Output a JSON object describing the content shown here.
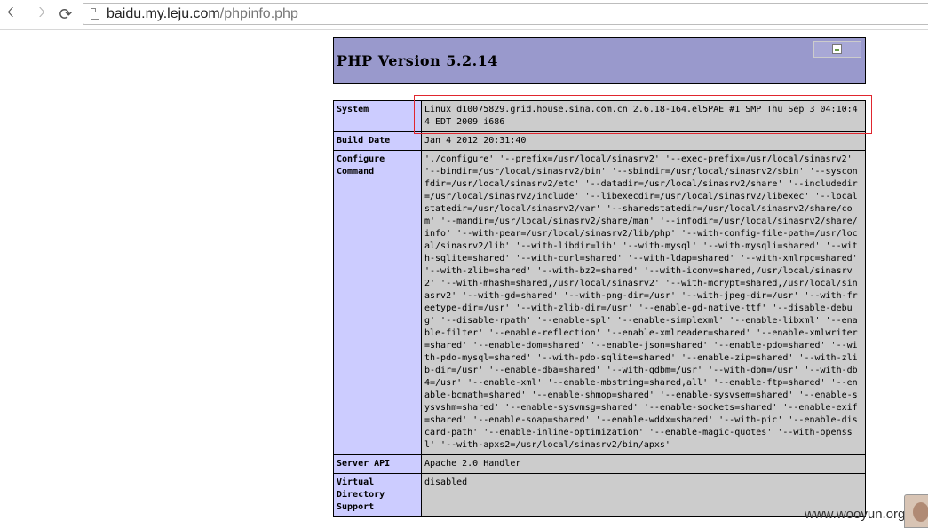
{
  "browser": {
    "url_host": "baidu.my.leju.com",
    "url_path": "/phpinfo.php"
  },
  "php": {
    "title": "PHP Version 5.2.14",
    "rows": [
      {
        "key": "System",
        "value": "Linux d10075829.grid.house.sina.com.cn 2.6.18-164.el5PAE #1 SMP Thu Sep 3 04:10:44 EDT 2009 i686"
      },
      {
        "key": "Build Date",
        "value": "Jan 4 2012 20:31:40"
      },
      {
        "key": "Configure Command",
        "value": "'./configure' '--prefix=/usr/local/sinasrv2' '--exec-prefix=/usr/local/sinasrv2' '--bindir=/usr/local/sinasrv2/bin' '--sbindir=/usr/local/sinasrv2/sbin' '--sysconfdir=/usr/local/sinasrv2/etc' '--datadir=/usr/local/sinasrv2/share' '--includedir=/usr/local/sinasrv2/include' '--libexecdir=/usr/local/sinasrv2/libexec' '--localstatedir=/usr/local/sinasrv2/var' '--sharedstatedir=/usr/local/sinasrv2/share/com' '--mandir=/usr/local/sinasrv2/share/man' '--infodir=/usr/local/sinasrv2/share/info' '--with-pear=/usr/local/sinasrv2/lib/php' '--with-config-file-path=/usr/local/sinasrv2/lib' '--with-libdir=lib' '--with-mysql' '--with-mysqli=shared' '--with-sqlite=shared' '--with-curl=shared' '--with-ldap=shared' '--with-xmlrpc=shared' '--with-zlib=shared' '--with-bz2=shared' '--with-iconv=shared,/usr/local/sinasrv2' '--with-mhash=shared,/usr/local/sinasrv2' '--with-mcrypt=shared,/usr/local/sinasrv2' '--with-gd=shared' '--with-png-dir=/usr' '--with-jpeg-dir=/usr' '--with-freetype-dir=/usr' '--with-zlib-dir=/usr' '--enable-gd-native-ttf' '--disable-debug' '--disable-rpath' '--enable-spl' '--enable-simplexml' '--enable-libxml' '--enable-filter' '--enable-reflection' '--enable-xmlreader=shared' '--enable-xmlwriter=shared' '--enable-dom=shared' '--enable-json=shared' '--enable-pdo=shared' '--with-pdo-mysql=shared' '--with-pdo-sqlite=shared' '--enable-zip=shared' '--with-zlib-dir=/usr' '--enable-dba=shared' '--with-gdbm=/usr' '--with-dbm=/usr' '--with-db4=/usr' '--enable-xml' '--enable-mbstring=shared,all' '--enable-ftp=shared' '--enable-bcmath=shared' '--enable-shmop=shared' '--enable-sysvsem=shared' '--enable-sysvshm=shared' '--enable-sysvmsg=shared' '--enable-sockets=shared' '--enable-exif=shared' '--enable-soap=shared' '--enable-wddx=shared' '--with-pic' '--enable-discard-path' '--enable-inline-optimization' '--enable-magic-quotes' '--with-openssl' '--with-apxs2=/usr/local/sinasrv2/bin/apxs'"
      },
      {
        "key": "Server API",
        "value": "Apache 2.0 Handler"
      },
      {
        "key": "Virtual Directory Support",
        "value": "disabled"
      }
    ]
  },
  "overlay": {
    "watermark": "www.wooyun.org",
    "highlight_color": "#e0262e"
  },
  "icons": {
    "back": "arrow-left-icon",
    "forward": "arrow-right-icon",
    "reload": "reload-icon",
    "page": "page-icon",
    "logo": "broken-image-icon"
  }
}
